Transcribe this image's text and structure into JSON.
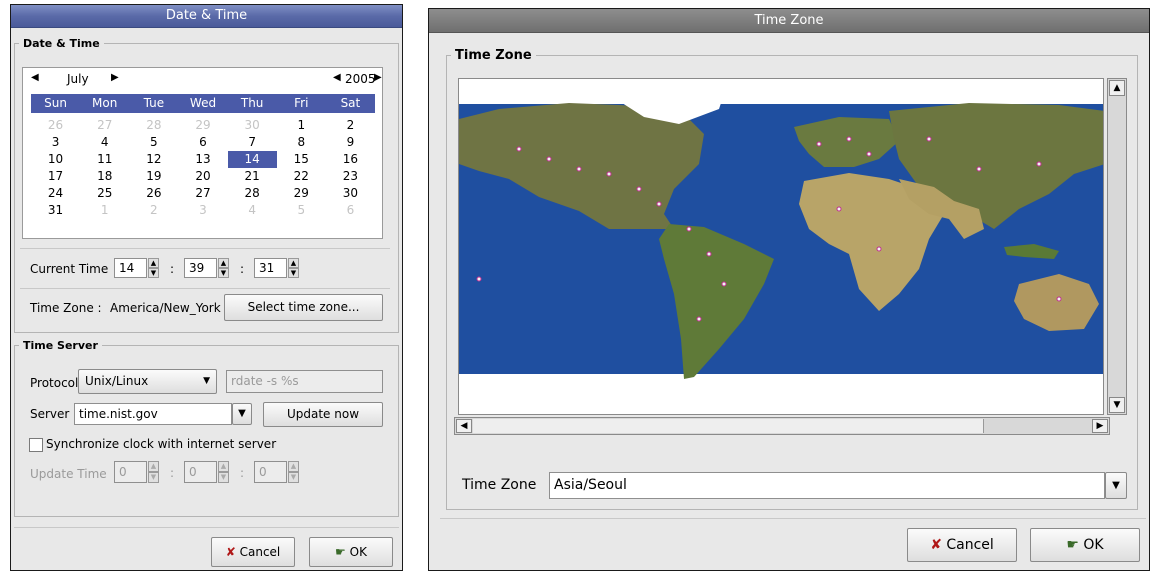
{
  "left_window": {
    "title": "Date & Time",
    "date_group_label": "Date & Time",
    "calendar": {
      "month": "July",
      "year": "2005",
      "weekdays": [
        "Sun",
        "Mon",
        "Tue",
        "Wed",
        "Thu",
        "Fri",
        "Sat"
      ],
      "days": [
        "26",
        "27",
        "28",
        "29",
        "30",
        "1",
        "2",
        "3",
        "4",
        "5",
        "6",
        "7",
        "8",
        "9",
        "10",
        "11",
        "12",
        "13",
        "14",
        "15",
        "16",
        "17",
        "18",
        "19",
        "20",
        "21",
        "22",
        "23",
        "24",
        "25",
        "26",
        "27",
        "28",
        "29",
        "30",
        "31",
        "1",
        "2",
        "3",
        "4",
        "5",
        "6"
      ],
      "other_month_indices": [
        0,
        1,
        2,
        3,
        4,
        36,
        37,
        38,
        39,
        40,
        41
      ],
      "selected_index": 18
    },
    "current_time_label": "Current Time",
    "hours": "14",
    "minutes": "39",
    "seconds": "31",
    "time_sep": ":",
    "timezone_label": "Time Zone :",
    "timezone_value": "America/New_York",
    "select_tz_button": "Select time zone...",
    "server_group_label": "Time Server",
    "protocol_label": "Protocol",
    "protocol_value": "Unix/Linux",
    "protocol_command": "rdate -s %s",
    "server_label": "Server",
    "server_value": "time.nist.gov",
    "update_now_button": "Update now",
    "sync_label": "Synchronize clock with internet server",
    "update_time_label": "Update Time",
    "update_hours": "0",
    "update_minutes": "0",
    "update_seconds": "0",
    "cancel_button": "Cancel",
    "ok_button": "OK"
  },
  "right_window": {
    "title": "Time Zone",
    "group_label": "Time Zone",
    "timezone_label": "Time Zone",
    "timezone_value": "Asia/Seoul",
    "cancel_button": "Cancel",
    "ok_button": "OK"
  },
  "colors": {
    "accent": "#4a5aa8",
    "ocean": "#1f4fa0",
    "land": "#7a7a48",
    "city_marker": "#e060c0"
  },
  "icons": {
    "cancel": "x-icon",
    "ok": "hand-check-icon"
  }
}
